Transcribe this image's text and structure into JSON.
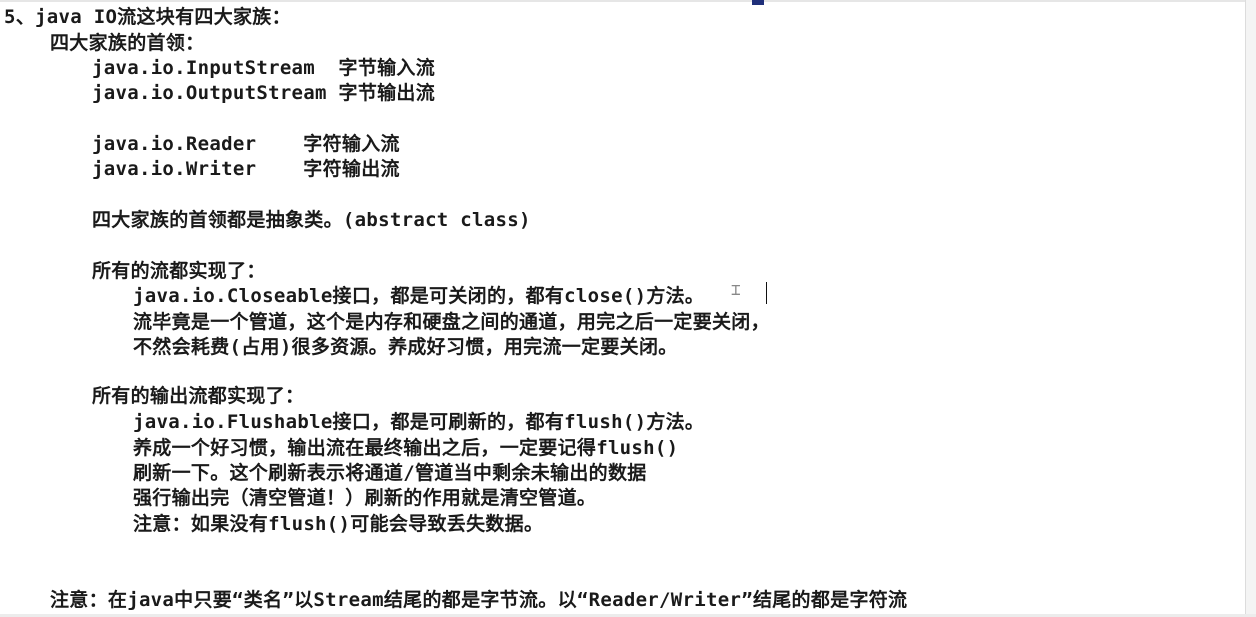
{
  "doc": {
    "lines": [
      "5、java IO流这块有四大家族：",
      "四大家族的首领：",
      "java.io.InputStream  字节输入流",
      "java.io.OutputStream 字节输出流",
      "java.io.Reader    字符输入流",
      "java.io.Writer    字符输出流",
      "四大家族的首领都是抽象类。(abstract class)",
      "所有的流都实现了：",
      "java.io.Closeable接口，都是可关闭的，都有close()方法。",
      "流毕竟是一个管道，这个是内存和硬盘之间的通道，用完之后一定要关闭，",
      "不然会耗费(占用)很多资源。养成好习惯，用完流一定要关闭。",
      "所有的输出流都实现了：",
      "java.io.Flushable接口，都是可刷新的，都有flush()方法。",
      "养成一个好习惯，输出流在最终输出之后，一定要记得flush()",
      "刷新一下。这个刷新表示将通道/管道当中剩余未输出的数据",
      "强行输出完（清空管道！）刷新的作用就是清空管道。",
      "注意：如果没有flush()可能会导致丢失数据。",
      "注意：在java中只要“类名”以Stream结尾的都是字节流。以“Reader/Writer”结尾的都是字符流"
    ]
  }
}
